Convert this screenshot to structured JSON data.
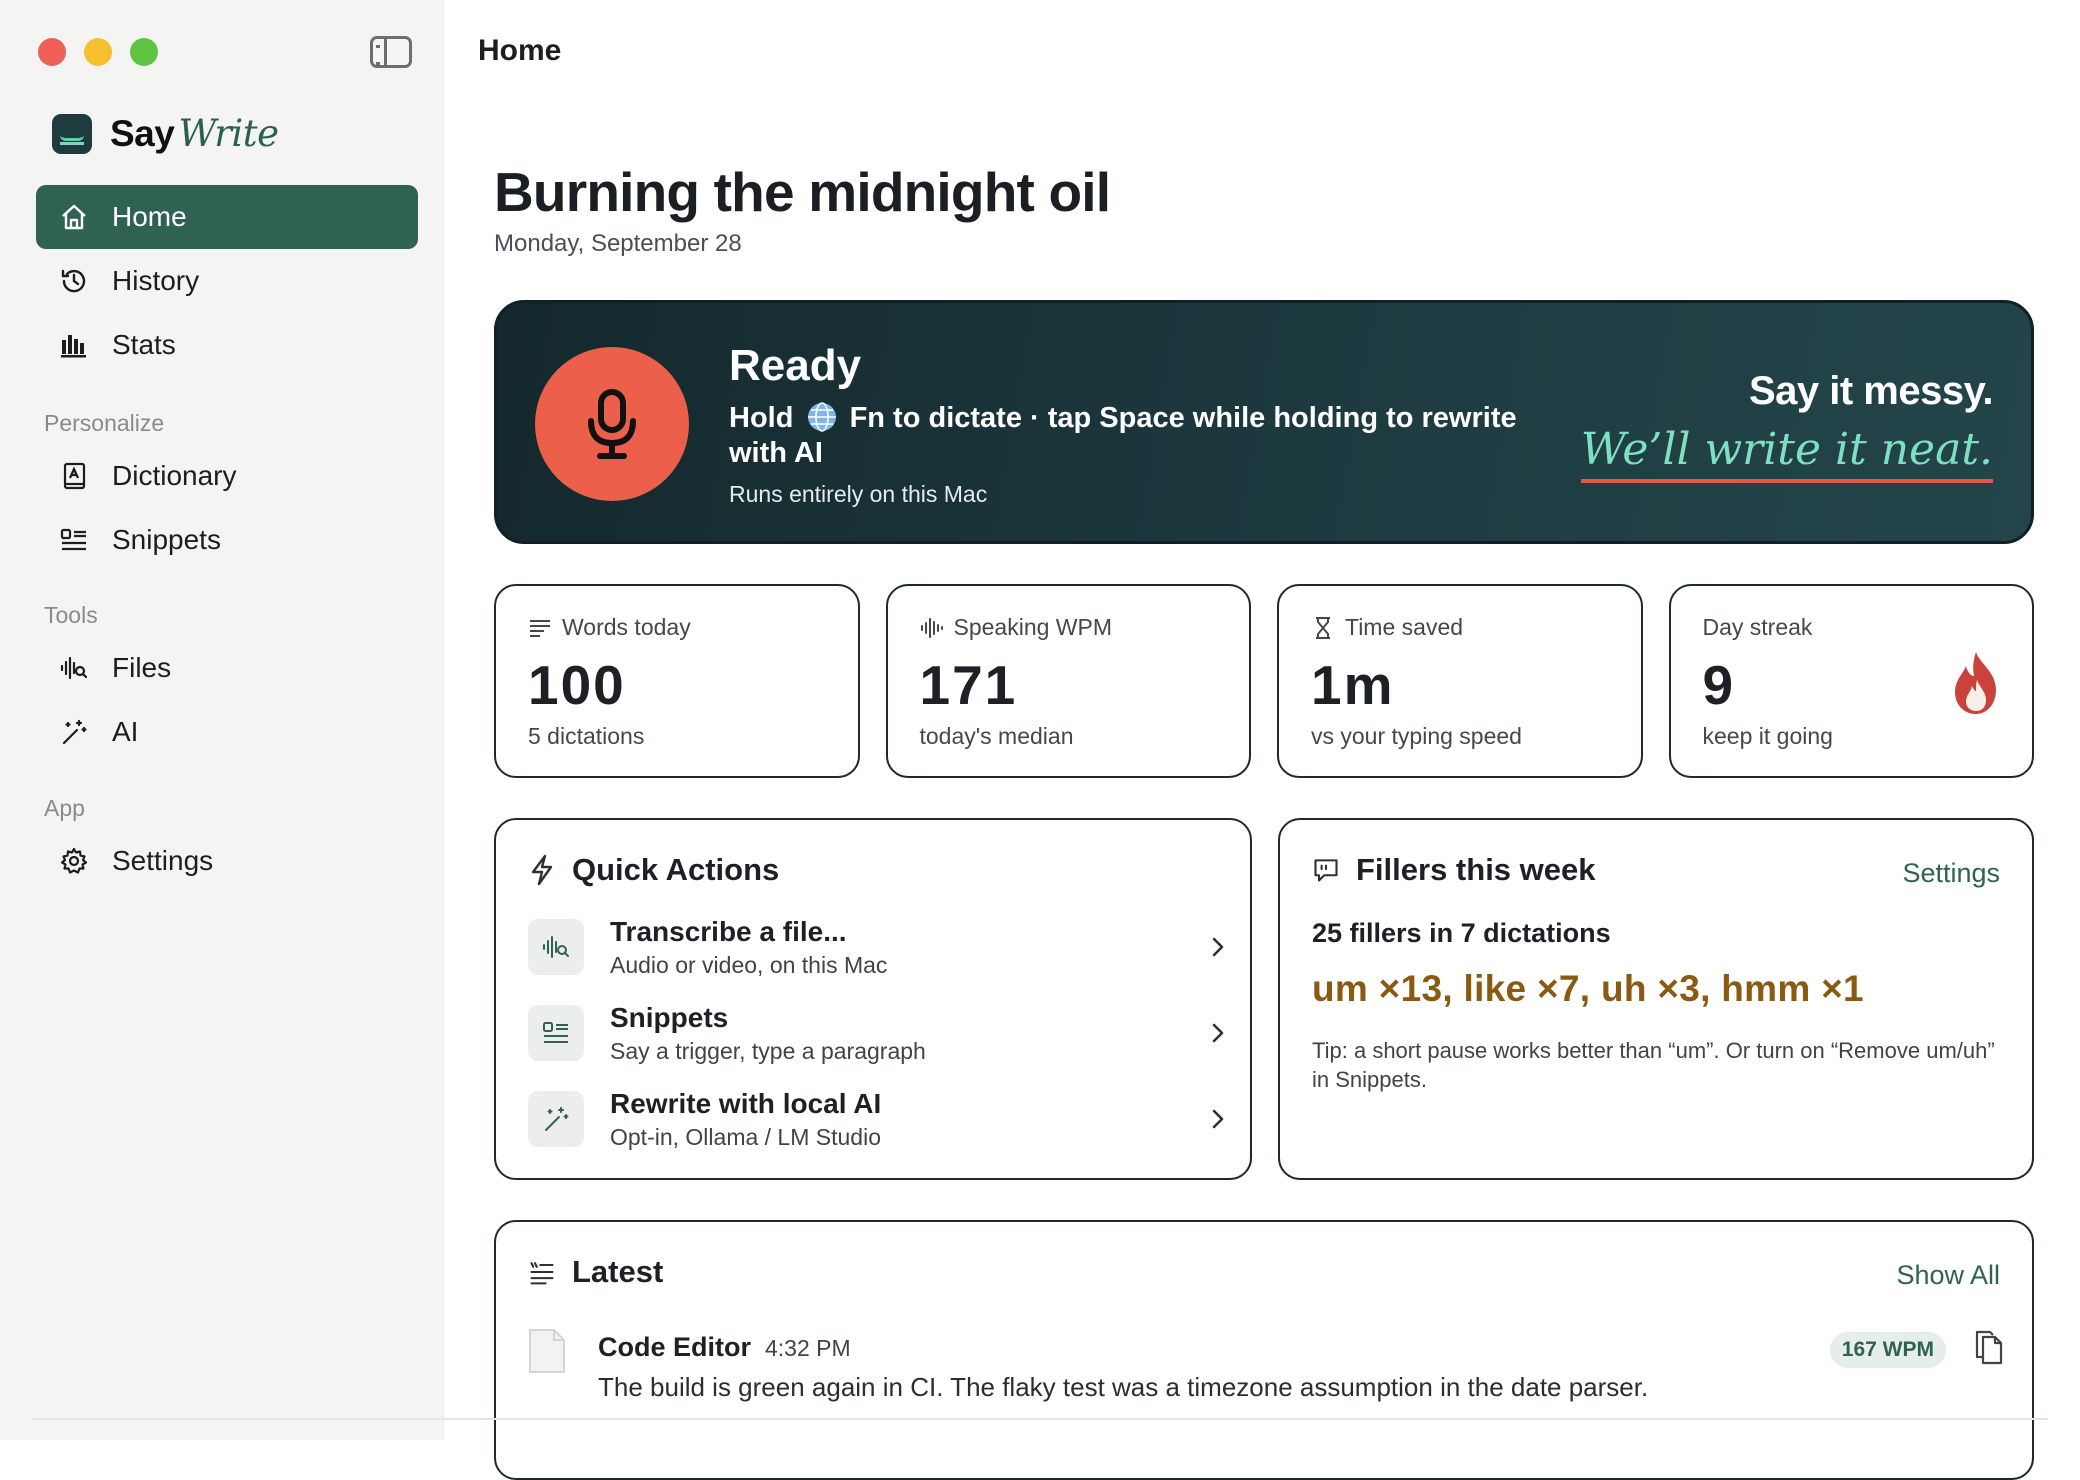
{
  "window": {
    "title": "Home"
  },
  "brand": {
    "say": "Say",
    "write": "Write"
  },
  "sidebar": {
    "items": [
      {
        "label": "Home",
        "icon": "home-icon",
        "active": true
      },
      {
        "label": "History",
        "icon": "history-icon"
      },
      {
        "label": "Stats",
        "icon": "stats-icon"
      }
    ],
    "sections": [
      {
        "label": "Personalize",
        "items": [
          {
            "label": "Dictionary",
            "icon": "dictionary-icon"
          },
          {
            "label": "Snippets",
            "icon": "snippets-icon"
          }
        ]
      },
      {
        "label": "Tools",
        "items": [
          {
            "label": "Files",
            "icon": "waveform-search-icon"
          },
          {
            "label": "AI",
            "icon": "magic-wand-icon"
          }
        ]
      },
      {
        "label": "App",
        "items": [
          {
            "label": "Settings",
            "icon": "gear-icon"
          }
        ]
      }
    ]
  },
  "main": {
    "greeting": "Burning the midnight oil",
    "date": "Monday, September 28",
    "hero": {
      "status": "Ready",
      "hint_pre": "Hold",
      "hint_post": "Fn to dictate · tap Space while holding to rewrite with AI",
      "sub": "Runs entirely on this Mac",
      "tagline_1": "Say it messy.",
      "tagline_2": "We’ll write it neat."
    },
    "stats": [
      {
        "label": "Words today",
        "value": "100",
        "sub": "5 dictations",
        "icon": "text-lines-icon"
      },
      {
        "label": "Speaking WPM",
        "value": "171",
        "sub": "today's median",
        "icon": "waveform-icon"
      },
      {
        "label": "Time saved",
        "value": "1m",
        "sub": "vs your typing speed",
        "icon": "hourglass-icon"
      },
      {
        "label": "Day streak",
        "value": "9",
        "sub": "keep it going",
        "icon": "flame-icon"
      }
    ],
    "quick_actions": {
      "title": "Quick Actions",
      "items": [
        {
          "title": "Transcribe a file...",
          "desc": "Audio or video, on this Mac",
          "icon": "waveform-search-icon"
        },
        {
          "title": "Snippets",
          "desc": "Say a trigger, type a paragraph",
          "icon": "snippets-icon"
        },
        {
          "title": "Rewrite with local AI",
          "desc": "Opt-in, Ollama / LM Studio",
          "icon": "magic-wand-icon"
        }
      ]
    },
    "fillers": {
      "title": "Fillers this week",
      "link": "Settings",
      "count": "25 fillers in 7 dictations",
      "list": "um ×13, like ×7, uh ×3, hmm ×1",
      "tip": "Tip: a short pause works better than “um”. Or turn on “Remove um/uh” in Snippets."
    },
    "latest": {
      "title": "Latest",
      "link": "Show All",
      "items": [
        {
          "app": "Code Editor",
          "time": "4:32 PM",
          "wpm": "167 WPM",
          "text": "The build is green again in CI. The flaky test was a timezone assumption in the date parser."
        }
      ]
    }
  },
  "colors": {
    "accent": "#2f6252",
    "hero_bg": "#1e3c41",
    "mic_red": "#ec5f4b",
    "filler_text": "#8a5a12",
    "tagline_green": "#7ee0c0"
  }
}
